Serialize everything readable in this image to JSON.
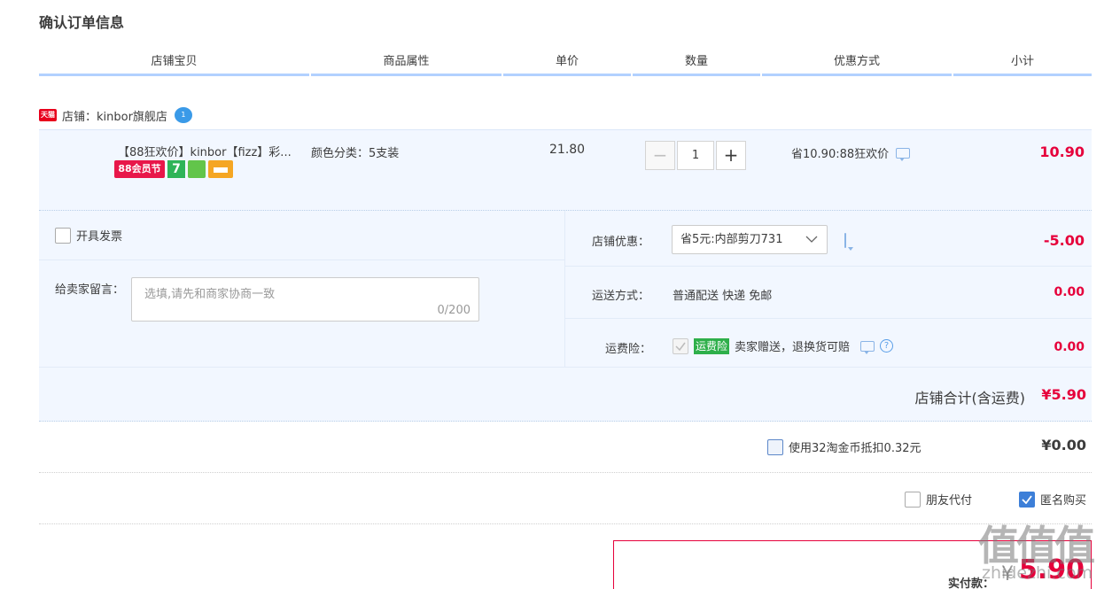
{
  "page_title": "确认订单信息",
  "columns": [
    "店铺宝贝",
    "商品属性",
    "单价",
    "数量",
    "优惠方式",
    "小计"
  ],
  "shop": {
    "label": "店铺：kinbor旗舰店",
    "platform_badge": "天猫",
    "wangwang_badge": "1"
  },
  "item": {
    "name": "【88狂欢价】kinbor【fizz】彩...",
    "attribute": "颜色分类：5支装",
    "unit_price": "21.80",
    "quantity": "1",
    "quantity_minus": "−",
    "quantity_plus": "+",
    "discount": "省10.90:88狂欢价",
    "subtotal": "10.90",
    "badges": {
      "b88": "88会员节",
      "b7": "7"
    }
  },
  "invoice_label": "开具发票",
  "message": {
    "label": "给卖家留言：",
    "placeholder": "选填,请先和商家协商一致",
    "counter": "0/200"
  },
  "shop_discount": {
    "label": "店铺优惠：",
    "selected": "省5元:内部剪刀731",
    "value": "-5.00"
  },
  "shipping": {
    "label": "运送方式：",
    "method": "普通配送 快递 免邮",
    "value": "0.00"
  },
  "insurance": {
    "label": "运费险：",
    "badge": "运费险",
    "text": "卖家赠送，退换货可赔",
    "value": "0.00",
    "qmark": "?"
  },
  "shop_total": {
    "label": "店铺合计(含运费)",
    "value": "¥5.90"
  },
  "taojinbi": {
    "label": "使用32淘金币抵扣0.32元",
    "value": "¥0.00"
  },
  "friend_pay": {
    "label": "朋友代付"
  },
  "anonymous": {
    "label": "匿名购买"
  },
  "payment": {
    "label": "实付款：",
    "currency": "¥",
    "value": "5.90"
  },
  "watermark": {
    "chars": "值值值",
    "domain": "zhidezhi.com"
  },
  "colors": {
    "accent_red": "#e6003b",
    "header_line": "#b2d1ff",
    "bg_blue": "#f2f7ff",
    "check_blue": "#3d7fd8"
  }
}
